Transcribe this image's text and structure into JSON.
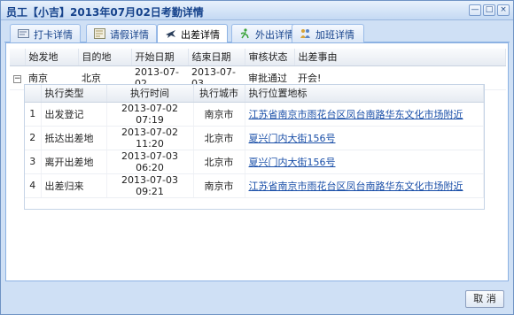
{
  "window": {
    "title": "员工【小吉】2013年07月02日考勤详情",
    "buttons": {
      "minimize": "—",
      "maximize": "□",
      "close": "×"
    }
  },
  "tabs": [
    {
      "label": "打卡详情",
      "icon": "clock-card-icon"
    },
    {
      "label": "请假详情",
      "icon": "leave-form-icon"
    },
    {
      "label": "出差详情",
      "icon": "airplane-icon",
      "active": true
    },
    {
      "label": "外出详情",
      "icon": "walking-person-icon"
    },
    {
      "label": "加班详情",
      "icon": "overtime-users-icon"
    }
  ],
  "trip_table": {
    "headers": [
      "始发地",
      "目的地",
      "开始日期",
      "结束日期",
      "审核状态",
      "出差事由"
    ],
    "rows": [
      {
        "expander": "−",
        "from": "南京",
        "to": "北京",
        "start": "2013-07-02",
        "end": "2013-07-03",
        "status": "审批通过",
        "reason": "开会!"
      }
    ]
  },
  "detail_table": {
    "headers": [
      "执行类型",
      "执行时间",
      "执行城市",
      "执行位置地标"
    ],
    "rows": [
      {
        "index": "1",
        "type": "出发登记",
        "time": "2013-07-02 07:19",
        "city": "南京市",
        "location": "江苏省南京市雨花台区凤台南路华东文化市场附近"
      },
      {
        "index": "2",
        "type": "抵达出差地",
        "time": "2013-07-02 11:20",
        "city": "北京市",
        "location": "夏兴门内大街156号"
      },
      {
        "index": "3",
        "type": "离开出差地",
        "time": "2013-07-03 06:20",
        "city": "北京市",
        "location": "夏兴门内大街156号"
      },
      {
        "index": "4",
        "type": "出差归来",
        "time": "2013-07-03 09:21",
        "city": "南京市",
        "location": "江苏省南京市雨花台区凤台南路华东文化市场附近"
      }
    ]
  },
  "footer": {
    "cancel_label": "取 消"
  },
  "colors": {
    "title_text": "#15428b",
    "link": "#1a4fa8",
    "frame": "#cfe0f5"
  }
}
